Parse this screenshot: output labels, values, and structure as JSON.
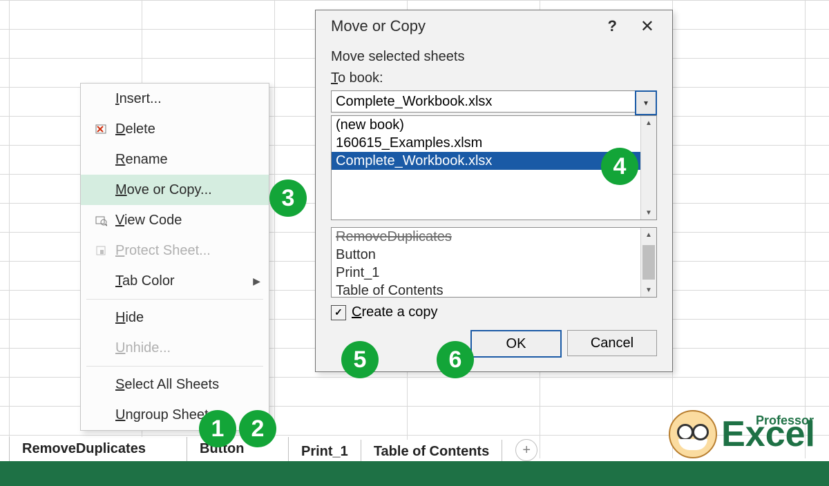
{
  "context_menu": {
    "items": [
      {
        "id": "insert",
        "label": "Insert...",
        "u": 0,
        "icon": "",
        "disabled": false
      },
      {
        "id": "delete",
        "label": "Delete",
        "u": 0,
        "icon": "delete",
        "disabled": false
      },
      {
        "id": "rename",
        "label": "Rename",
        "u": 0,
        "icon": "",
        "disabled": false
      },
      {
        "id": "move",
        "label": "Move or Copy...",
        "u": 0,
        "icon": "",
        "disabled": false,
        "highlight": true
      },
      {
        "id": "viewcode",
        "label": "View Code",
        "u": 0,
        "icon": "viewcode",
        "disabled": false
      },
      {
        "id": "protect",
        "label": "Protect Sheet...",
        "u": 0,
        "icon": "protect",
        "disabled": true
      },
      {
        "id": "tabcolor",
        "label": "Tab Color",
        "u": 0,
        "icon": "",
        "disabled": false,
        "sub": true
      },
      {
        "id": "hide",
        "label": "Hide",
        "u": 0,
        "icon": "",
        "disabled": false
      },
      {
        "id": "unhide",
        "label": "Unhide...",
        "u": 0,
        "icon": "",
        "disabled": true
      },
      {
        "id": "selectall",
        "label": "Select All Sheets",
        "u": 0,
        "icon": "",
        "disabled": false
      },
      {
        "id": "ungroup",
        "label": "Ungroup Sheets",
        "u": 0,
        "icon": "",
        "disabled": false
      }
    ]
  },
  "dialog": {
    "title": "Move or Copy",
    "subtitle": "Move selected sheets",
    "to_book_label": "To book:",
    "to_book_value": "Complete_Workbook.xlsx",
    "book_options": [
      "(new book)",
      "160615_Examples.xlsm",
      "Complete_Workbook.xlsx"
    ],
    "selected_book_index": 2,
    "before_sheets": [
      "RemoveDuplicates",
      "Button",
      "Print_1",
      "Table of Contents"
    ],
    "create_copy_label": "Create a copy",
    "create_copy_checked": true,
    "ok_label": "OK",
    "cancel_label": "Cancel"
  },
  "sheet_tabs": [
    "RemoveDuplicates",
    "Button",
    "Print_1",
    "Table of Contents"
  ],
  "badges": [
    "1",
    "2",
    "3",
    "4",
    "5",
    "6"
  ],
  "logo": {
    "top": "Professor",
    "word": "Excel"
  }
}
